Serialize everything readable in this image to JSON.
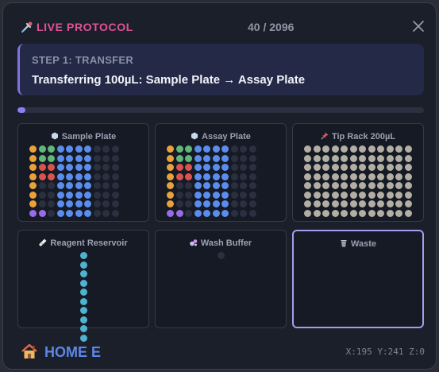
{
  "header": {
    "title": "LIVE PROTOCOL",
    "counter": "40 / 2096",
    "icon": "pipette-icon",
    "accent_color": "#e0529a"
  },
  "step": {
    "label": "STEP 1: TRANSFER",
    "description": "Transferring 100µL: Sample Plate → Assay Plate"
  },
  "progress": {
    "fraction": 0.019
  },
  "colors": {
    "orange": "#e9a23b",
    "green": "#5fb87a",
    "red": "#d9534f",
    "blue": "#5b8def",
    "purple": "#9a6ae8",
    "empty": "#2a3040",
    "tip": "#b3aea4",
    "cyan": "#4fb3cf"
  },
  "slots": [
    {
      "title": "Sample Plate",
      "icon": "flask-icon",
      "type": "plate",
      "rows": [
        "OGGBBBBEEE",
        "OGGBBBBEEE",
        "ORRBBBBEEE",
        "ORRBBBBEEE",
        "OEEBBBBEEE",
        "OEEBBBBEEE",
        "OEEBBBBEEE",
        "PPEBBBBEEE"
      ]
    },
    {
      "title": "Assay Plate",
      "icon": "flask-icon",
      "type": "plate",
      "rows": [
        "OGGBBBBEEE",
        "OGGBBBBEEE",
        "ORRBBBBEEE",
        "ORRBBBBEEE",
        "OEEBBBBEEE",
        "OEEBBBBEEE",
        "OEEBBBBEEE",
        "PPEBBBBEEE"
      ]
    },
    {
      "title": "Tip Rack 200µL",
      "icon": "pin-icon",
      "type": "tips",
      "rows": 8,
      "cols": 12
    },
    {
      "title": "Reagent Reservoir",
      "icon": "test-tube-icon",
      "type": "reservoir",
      "wells": 10
    },
    {
      "title": "Wash Buffer",
      "icon": "bubbles-icon",
      "type": "single",
      "wells": 1
    },
    {
      "title": "Waste",
      "icon": "trash-icon",
      "type": "empty",
      "active": true
    }
  ],
  "footer": {
    "home_label": "HOME E",
    "home_icon": "house-icon",
    "coords": "X:195 Y:241 Z:0"
  }
}
